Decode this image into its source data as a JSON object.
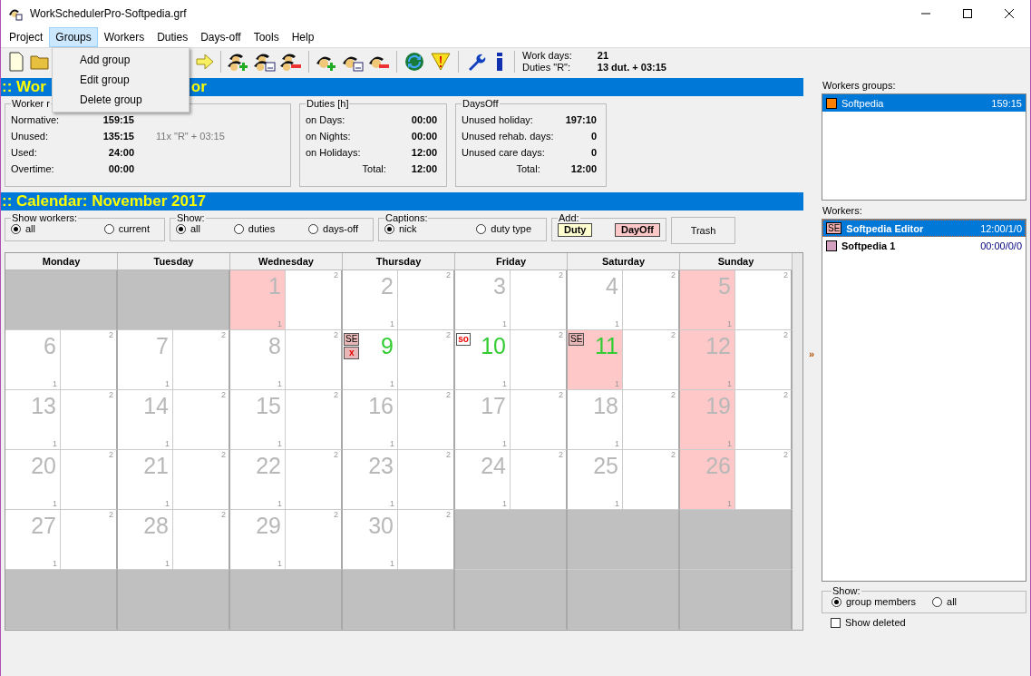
{
  "window": {
    "title": "WorkSchedulerPro-Softpedia.grf"
  },
  "menu": [
    {
      "label": "Project",
      "selected": false
    },
    {
      "label": "Groups",
      "selected": true
    },
    {
      "label": "Workers",
      "selected": false
    },
    {
      "label": "Duties",
      "selected": false
    },
    {
      "label": "Days-off",
      "selected": false
    },
    {
      "label": "Tools",
      "selected": false
    },
    {
      "label": "Help",
      "selected": false
    }
  ],
  "dropdown": [
    "Add group",
    "Edit group",
    "Delete group"
  ],
  "toolbar_info": [
    {
      "label": "Work days:",
      "value": "21"
    },
    {
      "label": "Duties \"R\":",
      "value": "13 dut. + 03:15"
    }
  ],
  "worker_header": {
    "left": ":: Wor",
    "right": "or"
  },
  "stats": [
    {
      "title": "Worker r",
      "kind": "worker",
      "rows": [
        {
          "label": "Normative:",
          "value": "159:15"
        },
        {
          "label": "Unused:",
          "value": "135:15",
          "note": "11x \"R\" + 03:15"
        },
        {
          "label": "Used:",
          "value": "24:00"
        },
        {
          "label": "Overtime:",
          "value": "00:00"
        }
      ]
    },
    {
      "title": "Duties [h]",
      "kind": "duties",
      "rows": [
        {
          "label": "on Days:",
          "value": "00:00"
        },
        {
          "label": "on Nights:",
          "value": "00:00"
        },
        {
          "label": "on Holidays:",
          "value": "12:00"
        },
        {
          "label": "Total:",
          "value": "12:00",
          "total": true
        }
      ]
    },
    {
      "title": "DaysOff",
      "kind": "daysoff",
      "rows": [
        {
          "label": "Unused holiday:",
          "value": "197:10"
        },
        {
          "label": "Unused rehab. days:",
          "value": "0"
        },
        {
          "label": "Unused care days:",
          "value": "0"
        },
        {
          "label": "Total:",
          "value": "12:00",
          "total": true
        }
      ]
    }
  ],
  "calendar_header": ":: Calendar: November 2017",
  "filters": [
    {
      "title": "Show workers:",
      "options": [
        {
          "label": "all",
          "selected": true
        },
        {
          "label": "current",
          "selected": false
        }
      ]
    },
    {
      "title": "Show:",
      "options": [
        {
          "label": "all",
          "selected": true
        },
        {
          "label": "duties",
          "selected": false
        },
        {
          "label": "days-off",
          "selected": false
        }
      ]
    },
    {
      "title": "Captions:",
      "options": [
        {
          "label": "nick",
          "selected": true
        },
        {
          "label": "duty type",
          "selected": false
        }
      ]
    }
  ],
  "add": {
    "title": "Add:",
    "buttons": [
      {
        "label": "Duty",
        "color": "#ffffd0"
      },
      {
        "label": "DayOff",
        "color": "#ffc8c8"
      }
    ]
  },
  "trash_button": "Trash",
  "calendar": {
    "weekdays": [
      "Monday",
      "Tuesday",
      "Wednesday",
      "Thursday",
      "Friday",
      "Saturday",
      "Sunday"
    ],
    "weeks": [
      [
        {
          "kind": "blank"
        },
        {
          "kind": "blank"
        },
        {
          "kind": "day",
          "day": "1",
          "off": true,
          "marked": false,
          "slots": [
            "1",
            "2"
          ]
        },
        {
          "kind": "day",
          "day": "2",
          "off": false,
          "marked": false,
          "slots": [
            "1",
            "2"
          ]
        },
        {
          "kind": "day",
          "day": "3",
          "off": false,
          "marked": false,
          "slots": [
            "1",
            "2"
          ]
        },
        {
          "kind": "day",
          "day": "4",
          "off": false,
          "marked": false,
          "slots": [
            "1",
            "2"
          ]
        },
        {
          "kind": "day",
          "day": "5",
          "off": true,
          "marked": false,
          "slots": [
            "1",
            "2"
          ]
        }
      ],
      [
        {
          "kind": "day",
          "day": "6",
          "off": false,
          "marked": false,
          "slots": [
            "1",
            "2"
          ]
        },
        {
          "kind": "day",
          "day": "7",
          "off": false,
          "marked": false,
          "slots": [
            "1",
            "2"
          ]
        },
        {
          "kind": "day",
          "day": "8",
          "off": false,
          "marked": false,
          "slots": [
            "1",
            "2"
          ]
        },
        {
          "kind": "day",
          "day": "9",
          "off": false,
          "marked": true,
          "slots": [
            "1",
            "2"
          ],
          "badges": [
            {
              "text": "SE",
              "kind": "nick"
            },
            {
              "text": "x",
              "kind": "absence"
            }
          ]
        },
        {
          "kind": "day",
          "day": "10",
          "off": false,
          "marked": true,
          "slots": [
            "1",
            "2"
          ],
          "badges": [
            {
              "text": "so",
              "kind": "type"
            }
          ]
        },
        {
          "kind": "day",
          "day": "11",
          "off": true,
          "marked": true,
          "slots": [
            "1",
            "2"
          ],
          "badges": [
            {
              "text": "SE",
              "kind": "nick"
            }
          ]
        },
        {
          "kind": "day",
          "day": "12",
          "off": true,
          "marked": false,
          "slots": [
            "1",
            "2"
          ]
        }
      ],
      [
        {
          "kind": "day",
          "day": "13",
          "off": false,
          "marked": false,
          "slots": [
            "1",
            "2"
          ]
        },
        {
          "kind": "day",
          "day": "14",
          "off": false,
          "marked": false,
          "slots": [
            "1",
            "2"
          ]
        },
        {
          "kind": "day",
          "day": "15",
          "off": false,
          "marked": false,
          "slots": [
            "1",
            "2"
          ]
        },
        {
          "kind": "day",
          "day": "16",
          "off": false,
          "marked": false,
          "slots": [
            "1",
            "2"
          ]
        },
        {
          "kind": "day",
          "day": "17",
          "off": false,
          "marked": false,
          "slots": [
            "1",
            "2"
          ]
        },
        {
          "kind": "day",
          "day": "18",
          "off": false,
          "marked": false,
          "slots": [
            "1",
            "2"
          ]
        },
        {
          "kind": "day",
          "day": "19",
          "off": true,
          "marked": false,
          "slots": [
            "1",
            "2"
          ]
        }
      ],
      [
        {
          "kind": "day",
          "day": "20",
          "off": false,
          "marked": false,
          "slots": [
            "1",
            "2"
          ]
        },
        {
          "kind": "day",
          "day": "21",
          "off": false,
          "marked": false,
          "slots": [
            "1",
            "2"
          ]
        },
        {
          "kind": "day",
          "day": "22",
          "off": false,
          "marked": false,
          "slots": [
            "1",
            "2"
          ]
        },
        {
          "kind": "day",
          "day": "23",
          "off": false,
          "marked": false,
          "slots": [
            "1",
            "2"
          ]
        },
        {
          "kind": "day",
          "day": "24",
          "off": false,
          "marked": false,
          "slots": [
            "1",
            "2"
          ]
        },
        {
          "kind": "day",
          "day": "25",
          "off": false,
          "marked": false,
          "slots": [
            "1",
            "2"
          ]
        },
        {
          "kind": "day",
          "day": "26",
          "off": true,
          "marked": false,
          "slots": [
            "1",
            "2"
          ]
        }
      ],
      [
        {
          "kind": "day",
          "day": "27",
          "off": false,
          "marked": false,
          "slots": [
            "1",
            "2"
          ]
        },
        {
          "kind": "day",
          "day": "28",
          "off": false,
          "marked": false,
          "slots": [
            "1",
            "2"
          ]
        },
        {
          "kind": "day",
          "day": "29",
          "off": false,
          "marked": false,
          "slots": [
            "1",
            "2"
          ]
        },
        {
          "kind": "day",
          "day": "30",
          "off": false,
          "marked": false,
          "slots": [
            "1",
            "2"
          ]
        },
        {
          "kind": "blank"
        },
        {
          "kind": "blank"
        },
        {
          "kind": "blank"
        }
      ],
      [
        {
          "kind": "blank"
        },
        {
          "kind": "blank"
        },
        {
          "kind": "blank"
        },
        {
          "kind": "blank"
        },
        {
          "kind": "blank"
        },
        {
          "kind": "blank"
        },
        {
          "kind": "blank"
        }
      ]
    ]
  },
  "splitter_glyph": "»",
  "sidebar": {
    "groups_label": "Workers groups:",
    "groups": [
      {
        "name": "Softpedia",
        "hours": "159:15",
        "color": "#ff8000",
        "selected": true
      }
    ],
    "workers_label": "Workers:",
    "workers": [
      {
        "name": "Softpedia Editor",
        "nick": "SE",
        "stats": "12:00/1/0",
        "color": "#f0b0b0",
        "selected": true
      },
      {
        "name": "Softpedia 1",
        "stats": "00:00/0/0",
        "color": "#d4a0c0",
        "selected": false
      }
    ],
    "show": {
      "title": "Show:",
      "options": [
        {
          "label": "group members",
          "selected": true
        },
        {
          "label": "all",
          "selected": false
        }
      ]
    },
    "show_deleted": {
      "label": "Show deleted",
      "checked": false
    }
  }
}
